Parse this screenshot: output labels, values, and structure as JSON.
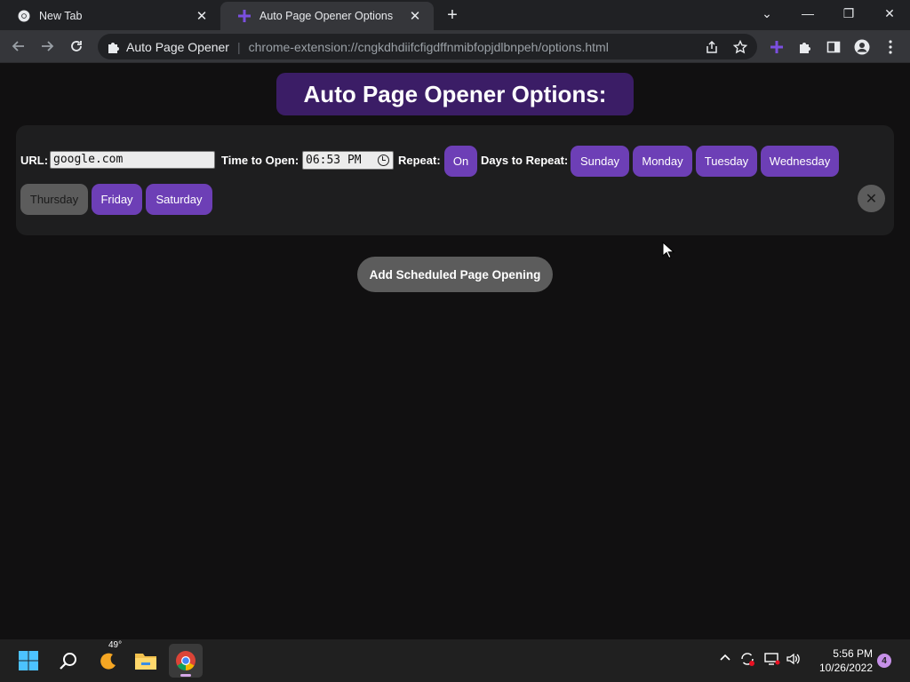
{
  "browser": {
    "tabs": [
      {
        "title": "New Tab",
        "close": "✕"
      },
      {
        "title": "Auto Page Opener Options",
        "close": "✕"
      }
    ],
    "new_tab_symbol": "+",
    "window_controls": {
      "tab_search": "⌄",
      "minimize": "—",
      "restore": "❐",
      "close": "✕"
    },
    "omnibox": {
      "site_name": "Auto Page Opener",
      "separator": "|",
      "url": "chrome-extension://cngkdhdiifcfigdffnmibfopjdlbnpeh/options.html"
    }
  },
  "page": {
    "heading": "Auto Page Opener Options:",
    "schedule": {
      "url_label": "URL:",
      "url_value": "google.com",
      "time_label": "Time to Open:",
      "time_value": "06:53 PM",
      "repeat_label": "Repeat:",
      "repeat_value": "On",
      "days_label": "Days to Repeat:",
      "days": [
        {
          "name": "Sunday",
          "selected": true
        },
        {
          "name": "Monday",
          "selected": true
        },
        {
          "name": "Tuesday",
          "selected": true
        },
        {
          "name": "Wednesday",
          "selected": true
        },
        {
          "name": "Thursday",
          "selected": false
        },
        {
          "name": "Friday",
          "selected": true
        },
        {
          "name": "Saturday",
          "selected": true
        }
      ],
      "remove_symbol": "✕"
    },
    "add_button": "Add Scheduled Page Opening",
    "colors": {
      "accent": "#6d3fb6",
      "heading_bg": "#3b1d66",
      "inactive": "#5c5c5c",
      "background": "#111011"
    }
  },
  "taskbar": {
    "weather_temp": "49°",
    "time": "5:56 PM",
    "date": "10/26/2022",
    "notification_count": "4"
  }
}
